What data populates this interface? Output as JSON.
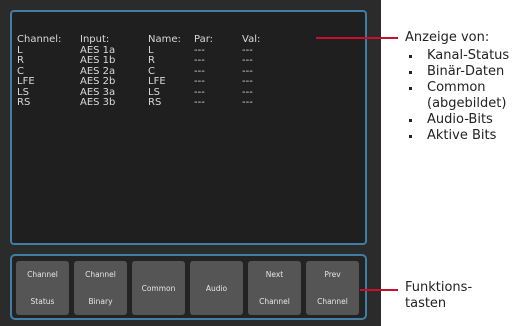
{
  "display": {
    "headers": [
      "Channel:",
      "Input:",
      "Name:",
      "Par:",
      "Val:"
    ],
    "rows": [
      [
        "L",
        "AES 1a",
        "L",
        "---",
        "---"
      ],
      [
        "R",
        "AES 1b",
        "R",
        "---",
        "---"
      ],
      [
        "C",
        "AES 2a",
        "C",
        "---",
        "---"
      ],
      [
        "LFE",
        "AES 2b",
        "LFE",
        "---",
        "---"
      ],
      [
        "LS",
        "AES 3a",
        "LS",
        "---",
        "---"
      ],
      [
        "RS",
        "AES 3b",
        "RS",
        "---",
        "---"
      ]
    ]
  },
  "softkeys": [
    {
      "line1": "Channel",
      "line2": "Status"
    },
    {
      "line1": "Channel",
      "line2": "Binary"
    },
    {
      "line1": "Common",
      "line2": ""
    },
    {
      "line1": "Audio",
      "line2": ""
    },
    {
      "line1": "Next",
      "line2": "Channel"
    },
    {
      "line1": "Prev",
      "line2": "Channel"
    }
  ],
  "annotations": {
    "display_title": "Anzeige von:",
    "display_items": [
      "Kanal-Status",
      "Binär-Daten",
      "Common",
      "(abgebildet)",
      "Audio-Bits",
      "Aktive Bits"
    ],
    "keys_label_line1": "Funktions-",
    "keys_label_line2": "tasten"
  }
}
